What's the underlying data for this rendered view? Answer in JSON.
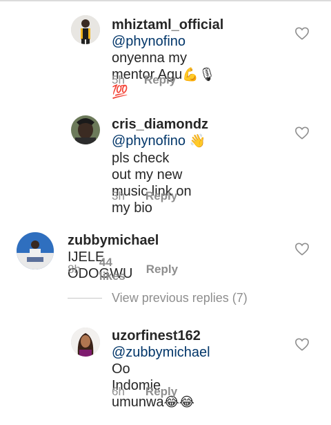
{
  "comments": [
    {
      "username": "mhiztaml_official",
      "mention": "@phynofino",
      "text_line1": " onyenna my",
      "text_line2": "mentor Agu",
      "emojis": "💪🎙💯",
      "time": "5h",
      "reply_label": "Reply"
    },
    {
      "username": "cris_diamondz",
      "mention": "@phynofino",
      "emojis": "👋",
      "text_line1": " pls check",
      "text_line2": "out my new music link on",
      "text_line3": "my bio",
      "time": "3h",
      "reply_label": "Reply"
    },
    {
      "username": "zubbymichael",
      "text": "IJELE  ODOGWU",
      "time": "8h",
      "likes": "44 likes",
      "reply_label": "Reply"
    },
    {
      "username": "uzorfinest162",
      "mention": "@zubbymichael",
      "text_line1": " Oo",
      "text_line2": "Indomie umunwa",
      "emojis": "😂😂",
      "time": "6h",
      "reply_label": "Reply"
    }
  ],
  "view_previous_replies": "View previous replies (7)",
  "icons": {
    "like": "heart-outline-icon"
  },
  "colors": {
    "mention": "#003569",
    "meta": "#8e8e8e"
  }
}
